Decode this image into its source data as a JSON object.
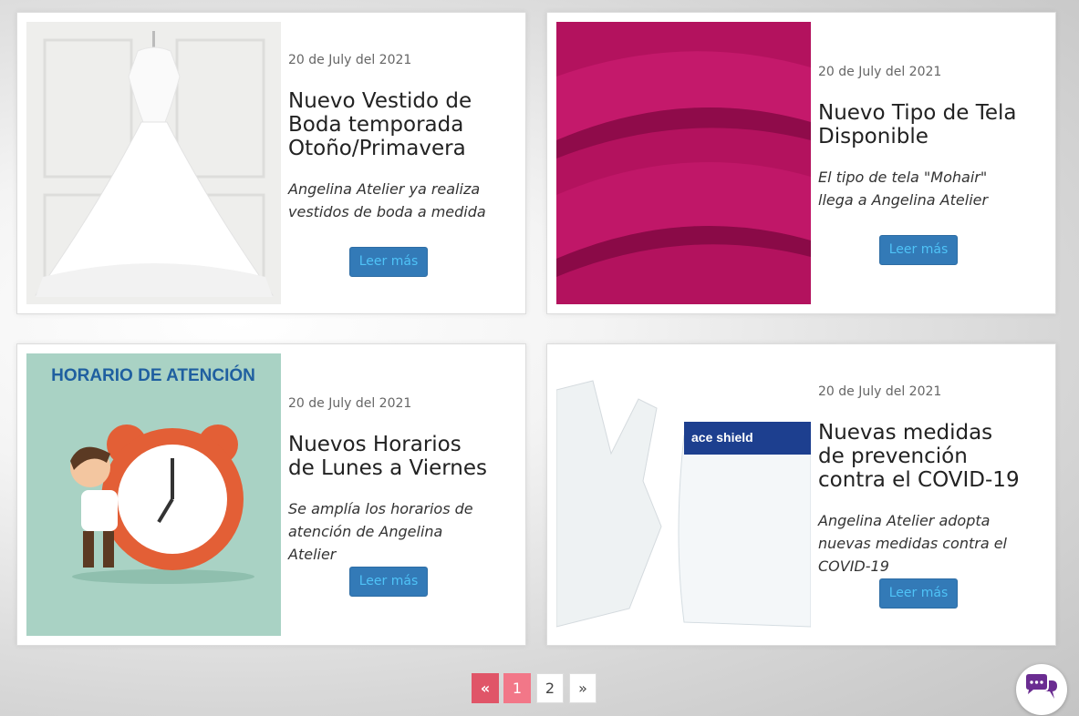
{
  "posts": [
    {
      "date": "20 de July del 2021",
      "title": "Nuevo Vestido de Boda temporada Otoño/Primavera",
      "excerpt": "Angelina Atelier ya realiza vestidos de boda a medida",
      "button": "Leer más",
      "image": "wedding-dress-photo"
    },
    {
      "date": "20 de July del 2021",
      "title": "Nuevo Tipo de Tela Disponible",
      "excerpt": "El tipo de tela \"Mohair\" llega a Angelina Atelier",
      "button": "Leer más",
      "image": "magenta-mohair-fabric-photo"
    },
    {
      "date": "20 de July del 2021",
      "title": "Nuevos Horarios de Lunes a Viernes",
      "excerpt": "Se amplía los horarios de atención de Angelina Atelier",
      "button": "Leer más",
      "image": "horario-de-atencion-illustration",
      "image_text": "HORARIO DE ATENCIÓN"
    },
    {
      "date": "20 de July del 2021",
      "title": "Nuevas medidas de prevención contra el COVID-19",
      "excerpt": "Angelina Atelier adopta nuevas medidas contra el COVID-19",
      "button": "Leer más",
      "image": "gloves-and-face-shield-photo",
      "image_text": "ace shield"
    }
  ],
  "pagination": {
    "prev": "«",
    "pages": [
      "1",
      "2"
    ],
    "current": "1",
    "next": "»"
  },
  "chat_icon": "chat-bubbles-icon",
  "colors": {
    "button_bg": "#337ab7",
    "button_text": "#4fc3f7",
    "pagination_prev": "#e05568",
    "pagination_active": "#f27788",
    "chat_icon": "#6a2c91"
  }
}
